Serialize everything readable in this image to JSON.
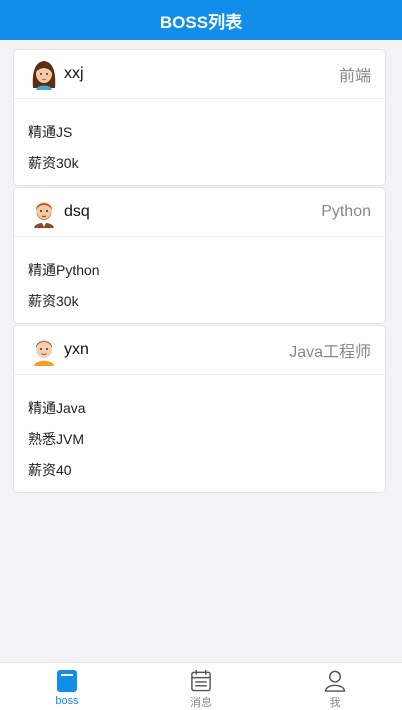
{
  "header": {
    "title": "BOSS列表"
  },
  "bosses": [
    {
      "name": "xxj",
      "title": "前端",
      "avatar": "female-avatar-icon",
      "desc": [
        "精通JS",
        "薪资30k"
      ]
    },
    {
      "name": "dsq",
      "title": "Python",
      "avatar": "bearded-man-avatar-icon",
      "desc": [
        "精通Python",
        "薪资30k"
      ]
    },
    {
      "name": "yxn",
      "title": "Java工程师",
      "avatar": "young-man-avatar-icon",
      "desc": [
        "精通Java",
        "熟悉JVM",
        "薪资40"
      ]
    }
  ],
  "tabbar": {
    "items": [
      {
        "label": "boss",
        "icon": "boss-tab-icon",
        "active": true
      },
      {
        "label": "消息",
        "icon": "message-tab-icon",
        "active": false
      },
      {
        "label": "我",
        "icon": "profile-tab-icon",
        "active": false
      }
    ]
  },
  "colors": {
    "accent": "#108ee9",
    "background": "#f3f3f7"
  }
}
